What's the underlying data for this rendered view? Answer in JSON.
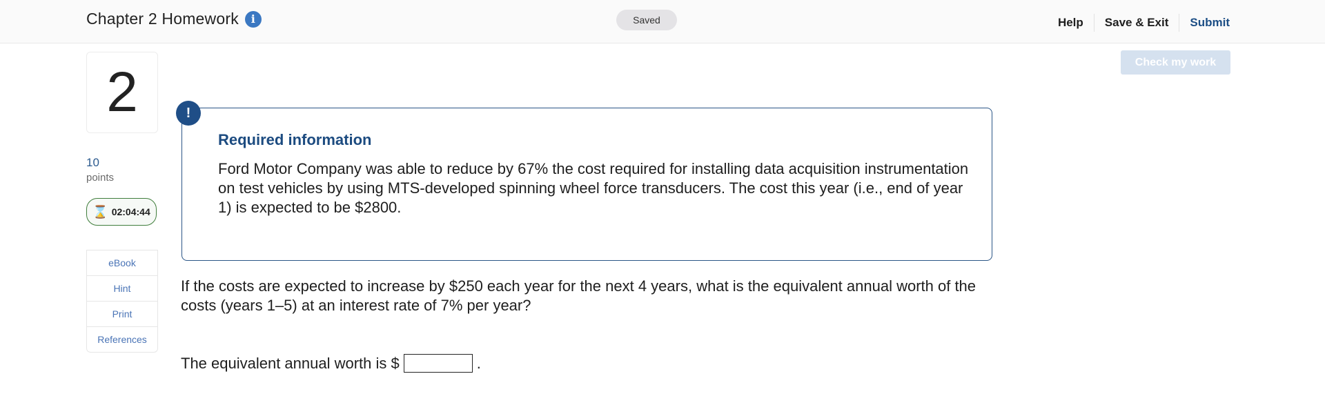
{
  "header": {
    "title": "Chapter 2 Homework",
    "info_icon": "i",
    "status": "Saved",
    "nav": {
      "help": "Help",
      "save_exit": "Save & Exit",
      "submit": "Submit"
    }
  },
  "check_work": "Check my work",
  "sidebar": {
    "question_number": "2",
    "points_value": "10",
    "points_label": "points",
    "timer": "02:04:44",
    "timer_icon": "⌛",
    "tools": [
      "eBook",
      "Hint",
      "Print",
      "References"
    ]
  },
  "required_info": {
    "icon": "!",
    "title": "Required information",
    "text": "Ford Motor Company was able to reduce by 67% the cost required for installing data acquisition instrumentation on test vehicles by using MTS-developed spinning wheel force transducers. The cost this year (i.e., end of year 1) is expected to be $2800."
  },
  "question": {
    "text": "If the costs are expected to increase by $250 each year for the next 4 years, what is the equivalent annual worth of the costs (years 1–5) at an interest rate of 7% per year?",
    "answer_prefix": "The equivalent annual worth is $",
    "answer_value": "",
    "answer_suffix": "."
  },
  "colors": {
    "accent": "#1c4e85",
    "link": "#4a74b6",
    "timer_green": "#3f7d3b",
    "check_button_disabled": "#d5e1ef"
  }
}
